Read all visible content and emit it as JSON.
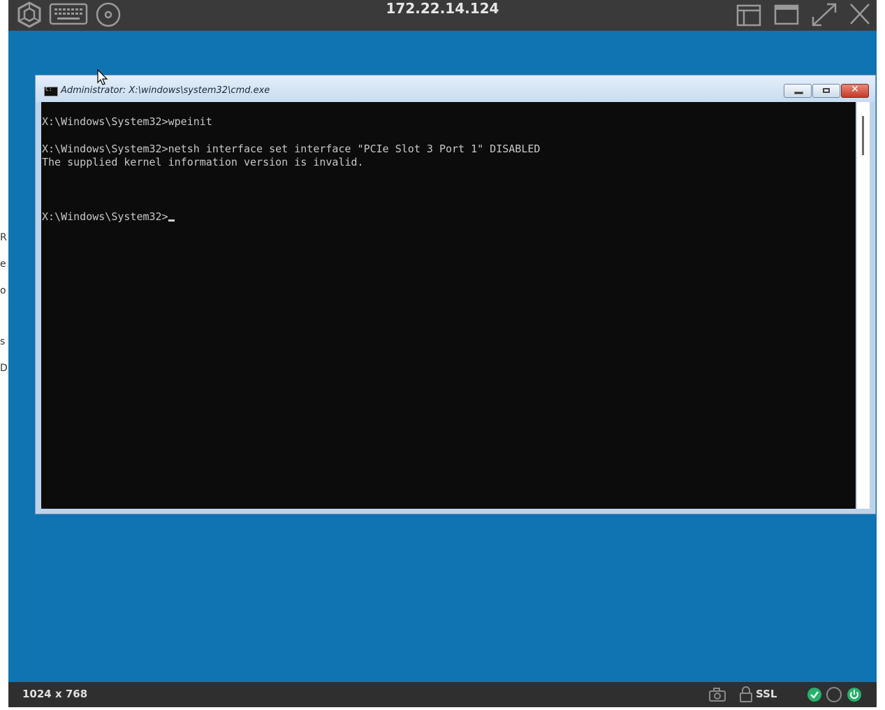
{
  "viewer": {
    "title": "172.22.14.124",
    "resolution": "1024 x 768",
    "ssl_label": "SSL"
  },
  "toolbar_icons": [
    "hexagon-logo-icon",
    "keyboard-icon",
    "disc-icon",
    "layout-icon",
    "window-icon",
    "fullscreen-icon",
    "close-icon"
  ],
  "status_icons": [
    "camera-icon",
    "lock-icon",
    "check-icon",
    "circle-icon",
    "power-icon"
  ],
  "colors": {
    "desktop": "#1073b2",
    "toolbar": "#3a3a3a",
    "console_bg": "#0c0c0c",
    "console_text": "#c8c8c8",
    "status_green": "#27b06a"
  },
  "cmd": {
    "title": "Administrator: X:\\windows\\system32\\cmd.exe",
    "lines": [
      "X:\\Windows\\System32>wpeinit",
      "",
      "X:\\Windows\\System32>netsh interface set interface \"PCIe Slot 3 Port 1\" DISABLED",
      "The supplied kernel information version is invalid.",
      "",
      "",
      "",
      "X:\\Windows\\System32>"
    ]
  },
  "left_fragments": [
    "R",
    "e",
    "o",
    "s",
    "D"
  ]
}
